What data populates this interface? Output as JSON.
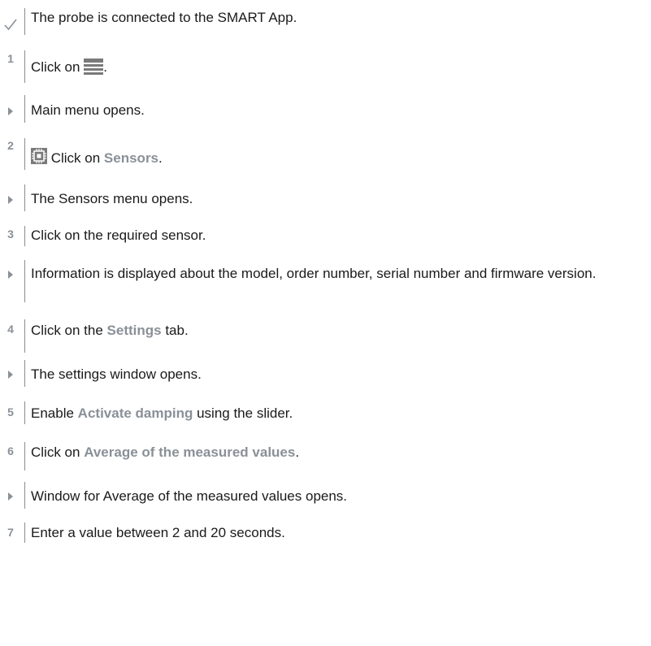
{
  "steps": [
    {
      "marker": "",
      "marker_type": "check",
      "parts": {
        "t1": "The probe is connected to the SMART App."
      }
    },
    {
      "marker": "1",
      "marker_type": "number",
      "parts": {
        "t1": "Click on ",
        "t2": "."
      },
      "icon": "hamburger-menu-icon"
    },
    {
      "marker": "",
      "marker_type": "arrow",
      "parts": {
        "t1": "Main menu opens."
      }
    },
    {
      "marker": "2",
      "marker_type": "number",
      "parts": {
        "t1": " Click on ",
        "kw": "Sensors",
        "t2": "."
      },
      "icon": "sensor-chip-icon"
    },
    {
      "marker": "",
      "marker_type": "arrow",
      "parts": {
        "t1": "The Sensors menu opens."
      }
    },
    {
      "marker": "3",
      "marker_type": "number",
      "parts": {
        "t1": "Click on the required sensor."
      }
    },
    {
      "marker": "",
      "marker_type": "arrow",
      "parts": {
        "t1": "Information is displayed about the model, order number, serial number and firmware version."
      }
    },
    {
      "marker": "4",
      "marker_type": "number",
      "parts": {
        "t1": "Click on the ",
        "kw": "Settings",
        "t2": " tab."
      }
    },
    {
      "marker": "",
      "marker_type": "arrow",
      "parts": {
        "t1": "The settings window opens."
      }
    },
    {
      "marker": "5",
      "marker_type": "number",
      "parts": {
        "t1": "Enable ",
        "kw": "Activate damping",
        "t2": " using the slider."
      }
    },
    {
      "marker": "6",
      "marker_type": "number",
      "parts": {
        "t1": "Click on ",
        "kw": "Average of the measured values",
        "t2": "."
      }
    },
    {
      "marker": "",
      "marker_type": "arrow",
      "parts": {
        "t1": "Window for Average of the measured values opens."
      }
    },
    {
      "marker": "7",
      "marker_type": "number",
      "parts": {
        "t1": "Enter a value between 2 and 20 seconds."
      }
    }
  ],
  "colors": {
    "keyword": "#8a9098",
    "marker": "#8a9098",
    "rule": "#8c8c8c",
    "text": "#1a1a1a"
  }
}
